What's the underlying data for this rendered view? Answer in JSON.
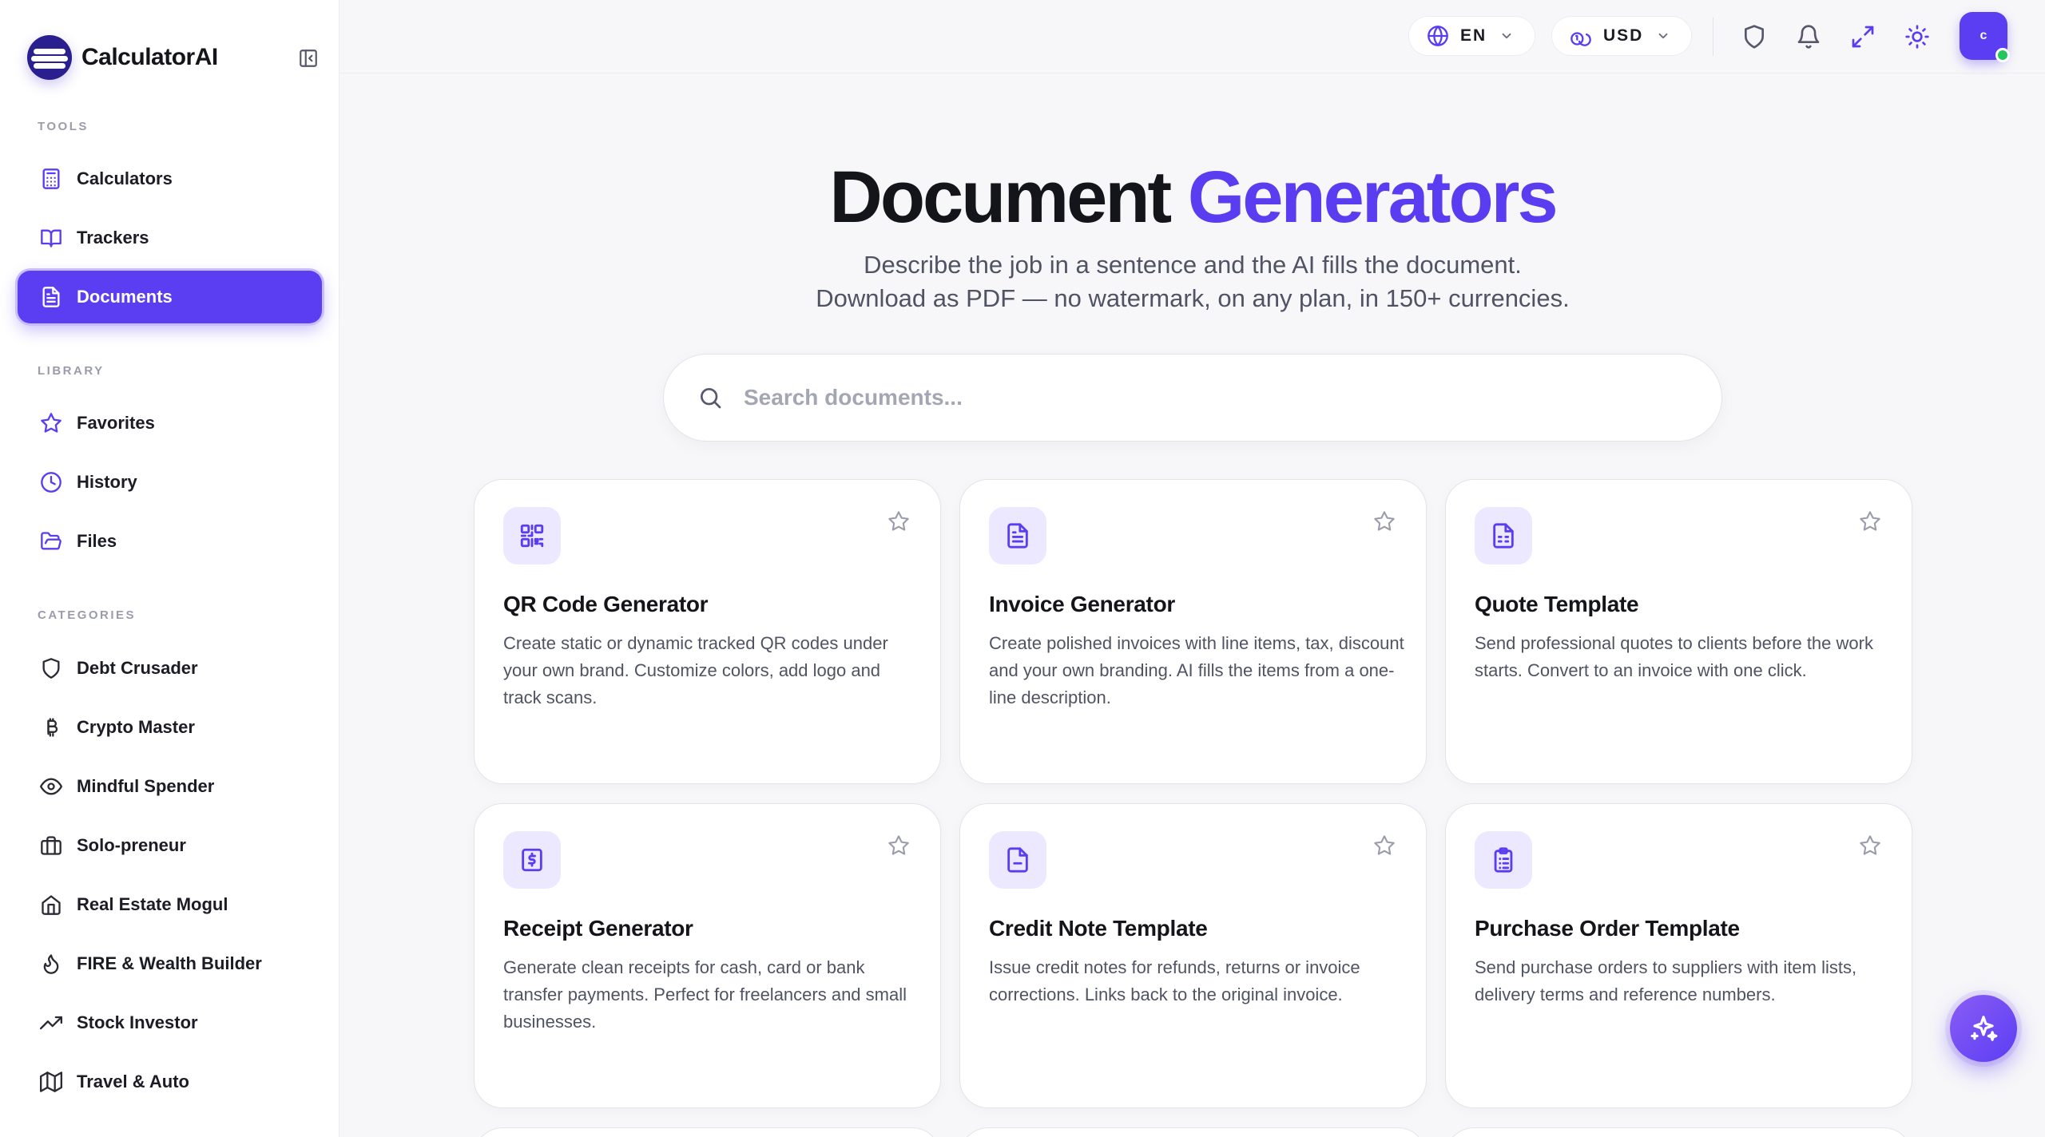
{
  "brand": {
    "name": "CalculatorAI"
  },
  "sidebar": {
    "sections": [
      {
        "title": "TOOLS",
        "items": [
          {
            "label": "Calculators",
            "icon": "calculator-icon",
            "active": false
          },
          {
            "label": "Trackers",
            "icon": "book-open-icon",
            "active": false
          },
          {
            "label": "Documents",
            "icon": "document-icon",
            "active": true
          }
        ]
      },
      {
        "title": "LIBRARY",
        "items": [
          {
            "label": "Favorites",
            "icon": "star-icon"
          },
          {
            "label": "History",
            "icon": "clock-icon"
          },
          {
            "label": "Files",
            "icon": "folder-open-icon"
          }
        ]
      },
      {
        "title": "CATEGORIES",
        "items": [
          {
            "label": "Debt Crusader",
            "icon": "shield-icon"
          },
          {
            "label": "Crypto Master",
            "icon": "bitcoin-icon"
          },
          {
            "label": "Mindful Spender",
            "icon": "eye-icon"
          },
          {
            "label": "Solo-preneur",
            "icon": "briefcase-icon"
          },
          {
            "label": "Real Estate Mogul",
            "icon": "home-icon"
          },
          {
            "label": "FIRE & Wealth Builder",
            "icon": "flame-icon"
          },
          {
            "label": "Stock Investor",
            "icon": "trending-up-icon"
          },
          {
            "label": "Travel & Auto",
            "icon": "map-icon"
          }
        ]
      }
    ]
  },
  "topbar": {
    "language": "EN",
    "currency": "USD",
    "avatar_initial": "c"
  },
  "hero": {
    "title_main": "Document",
    "title_accent": "Generators",
    "subtitle_line1": "Describe the job in a sentence and the AI fills the document.",
    "subtitle_line2": "Download as PDF — no watermark, on any plan, in 150+ currencies."
  },
  "search": {
    "placeholder": "Search documents..."
  },
  "cards": [
    {
      "title": "QR Code Generator",
      "icon": "qr-code-icon",
      "description": "Create static or dynamic tracked QR codes under your own brand. Customize colors, add logo and track scans."
    },
    {
      "title": "Invoice Generator",
      "icon": "file-text-icon",
      "description": "Create polished invoices with line items, tax, discount and your own branding. AI fills the items from a one-line description."
    },
    {
      "title": "Quote Template",
      "icon": "file-spreadsheet-icon",
      "description": "Send professional quotes to clients before the work starts. Convert to an invoice with one click."
    },
    {
      "title": "Receipt Generator",
      "icon": "receipt-dollar-icon",
      "description": "Generate clean receipts for cash, card or bank transfer payments. Perfect for freelancers and small businesses."
    },
    {
      "title": "Credit Note Template",
      "icon": "file-minus-icon",
      "description": "Issue credit notes for refunds, returns or invoice corrections. Links back to the original invoice."
    },
    {
      "title": "Purchase Order Template",
      "icon": "clipboard-list-icon",
      "description": "Send purchase orders to suppliers with item lists, delivery terms and reference numbers."
    }
  ],
  "colors": {
    "accent": "#5B3EF2",
    "accent_soft": "#ECE8FF",
    "text": "#14141B",
    "muted": "#505363"
  }
}
